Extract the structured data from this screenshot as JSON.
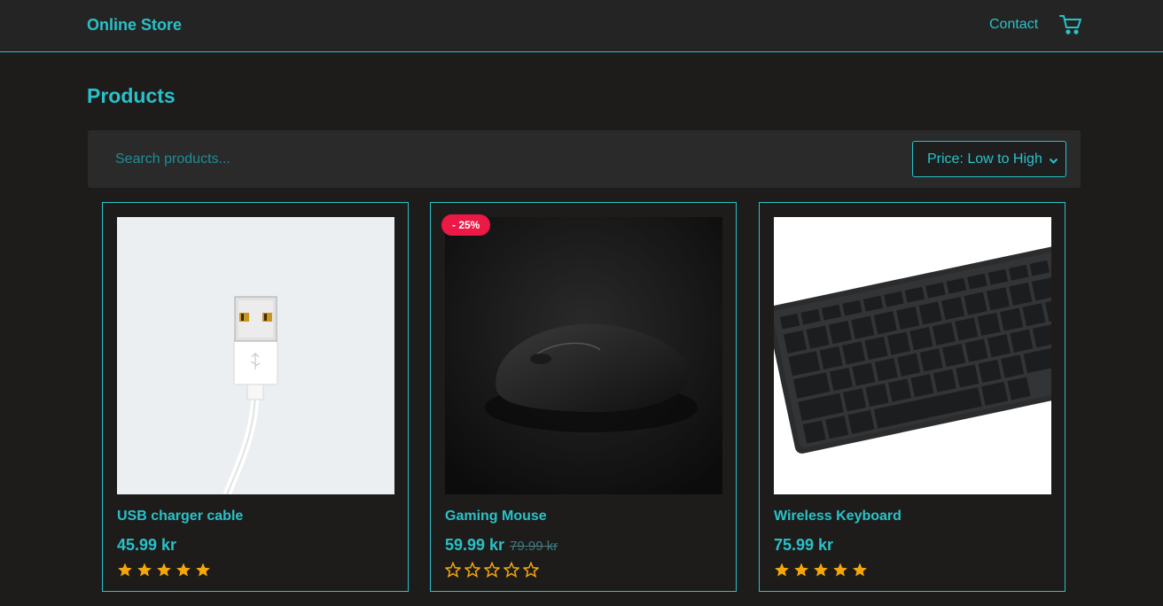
{
  "navbar": {
    "brand": "Online Store",
    "contact_label": "Contact",
    "cart_icon": "cart-icon"
  },
  "page": {
    "title": "Products"
  },
  "filters": {
    "search_placeholder": "Search products...",
    "search_value": "",
    "sort_selected": "Price: Low to High"
  },
  "products": [
    {
      "title": "USB charger cable",
      "price": "45.99 kr",
      "old_price": "",
      "discount": "",
      "rating": 5,
      "image": "usb-cable-photo"
    },
    {
      "title": "Gaming Mouse",
      "price": "59.99 kr",
      "old_price": "79.99 kr",
      "discount": "- 25%",
      "rating": 0,
      "image": "gaming-mouse-photo"
    },
    {
      "title": "Wireless Keyboard",
      "price": "75.99 kr",
      "old_price": "",
      "discount": "",
      "rating": 5,
      "image": "keyboard-photo"
    }
  ],
  "colors": {
    "accent": "#29c2c9",
    "background": "#1d1c1b",
    "navbar": "#242424",
    "badge": "#ec1846",
    "star": "#f5a70a"
  }
}
